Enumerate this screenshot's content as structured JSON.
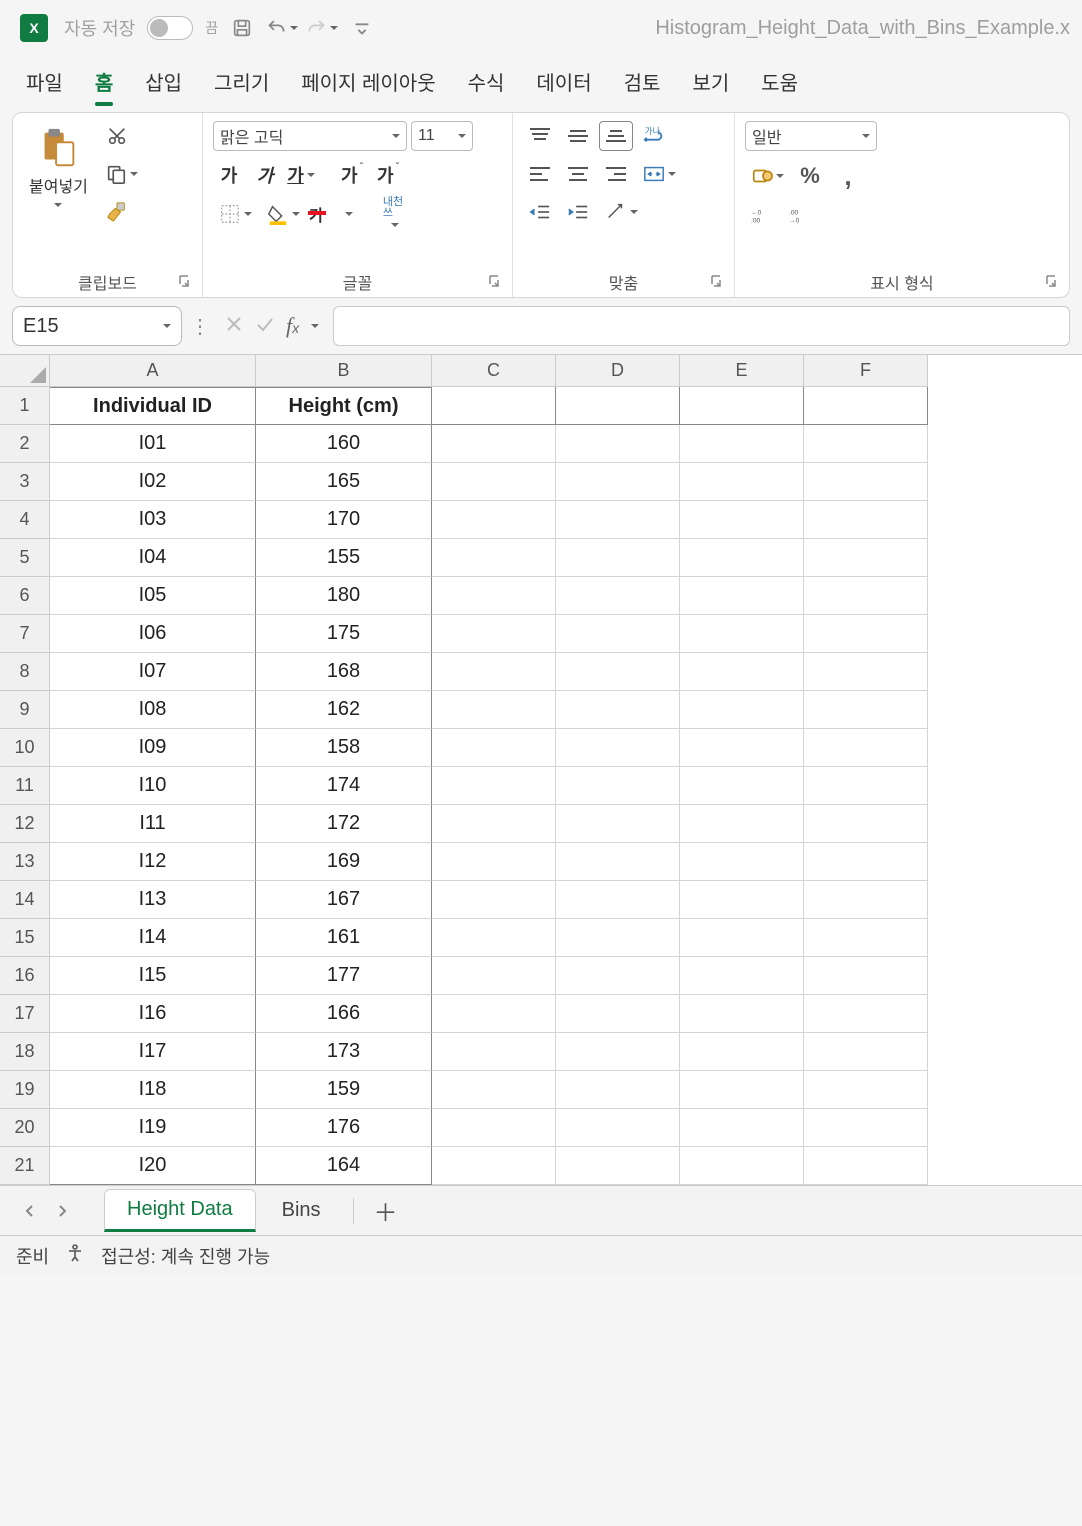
{
  "title": "Histogram_Height_Data_with_Bins_Example.x",
  "autosave_label": "자동 저장",
  "autosave_state": "끔",
  "ribbon_tabs": [
    "파일",
    "홈",
    "삽입",
    "그리기",
    "페이지 레이아웃",
    "수식",
    "데이터",
    "검토",
    "보기",
    "도움"
  ],
  "active_tab_index": 1,
  "clipboard": {
    "paste": "붙여넣기",
    "group_label": "클립보드"
  },
  "font": {
    "name": "맑은 고딕",
    "size": "11",
    "group_label": "글꼴",
    "indent_label": "내천\n쓰"
  },
  "alignment": {
    "group_label": "맞춤"
  },
  "number_format": {
    "name": "일반",
    "group_label": "표시 형식"
  },
  "namebox": "E15",
  "grid": {
    "columns": [
      "A",
      "B",
      "C",
      "D",
      "E",
      "F"
    ],
    "headers": [
      "Individual ID",
      "Height (cm)"
    ],
    "rows": [
      {
        "n": 1,
        "a": "Individual ID",
        "b": "Height (cm)",
        "hdr": true
      },
      {
        "n": 2,
        "a": "I01",
        "b": "160"
      },
      {
        "n": 3,
        "a": "I02",
        "b": "165"
      },
      {
        "n": 4,
        "a": "I03",
        "b": "170"
      },
      {
        "n": 5,
        "a": "I04",
        "b": "155"
      },
      {
        "n": 6,
        "a": "I05",
        "b": "180"
      },
      {
        "n": 7,
        "a": "I06",
        "b": "175"
      },
      {
        "n": 8,
        "a": "I07",
        "b": "168"
      },
      {
        "n": 9,
        "a": "I08",
        "b": "162"
      },
      {
        "n": 10,
        "a": "I09",
        "b": "158"
      },
      {
        "n": 11,
        "a": "I10",
        "b": "174"
      },
      {
        "n": 12,
        "a": "I11",
        "b": "172"
      },
      {
        "n": 13,
        "a": "I12",
        "b": "169"
      },
      {
        "n": 14,
        "a": "I13",
        "b": "167"
      },
      {
        "n": 15,
        "a": "I14",
        "b": "161"
      },
      {
        "n": 16,
        "a": "I15",
        "b": "177"
      },
      {
        "n": 17,
        "a": "I16",
        "b": "166"
      },
      {
        "n": 18,
        "a": "I17",
        "b": "173"
      },
      {
        "n": 19,
        "a": "I18",
        "b": "159"
      },
      {
        "n": 20,
        "a": "I19",
        "b": "176"
      },
      {
        "n": 21,
        "a": "I20",
        "b": "164"
      }
    ]
  },
  "sheet_tabs": [
    "Height Data",
    "Bins"
  ],
  "active_sheet_index": 0,
  "status": {
    "ready": "준비",
    "accessibility": "접근성: 계속 진행 가능"
  }
}
